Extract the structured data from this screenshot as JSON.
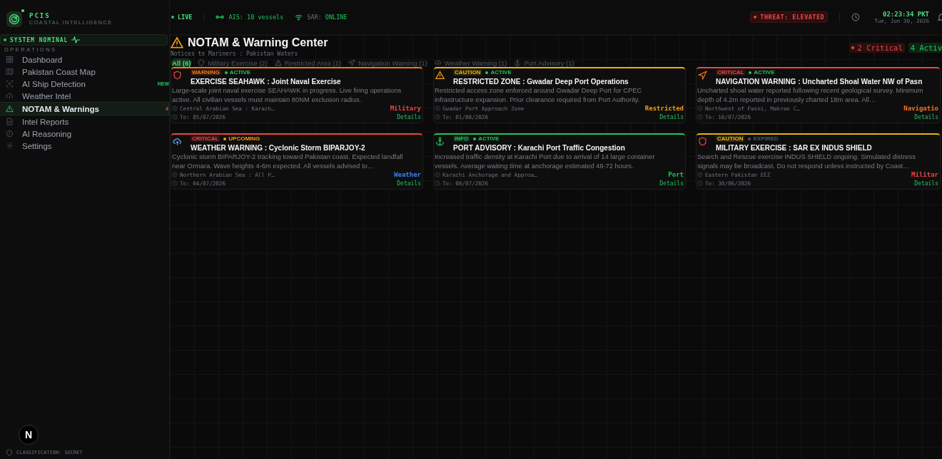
{
  "brand": {
    "name": "PCIS",
    "subtitle": "COASTAL INTELLIGENCE"
  },
  "system_status": "SYSTEM NOMINAL",
  "sidebar": {
    "section": "OPERATIONS",
    "items": [
      {
        "label": "Dashboard",
        "kind": "grid",
        "selected": false
      },
      {
        "label": "Pakistan Coast Map",
        "kind": "map",
        "selected": false
      },
      {
        "label": "AI Ship Detection",
        "kind": "scan",
        "selected": false,
        "badge": "NEW"
      },
      {
        "label": "Weather Intel",
        "kind": "cloud",
        "selected": false
      },
      {
        "label": "NOTAM & Warnings",
        "kind": "warning",
        "selected": true,
        "badge": "4"
      },
      {
        "label": "Intel Reports",
        "kind": "doc",
        "selected": false
      },
      {
        "label": "AI Reasoning",
        "kind": "brain",
        "selected": false
      },
      {
        "label": "Settings",
        "kind": "gear",
        "selected": false
      }
    ],
    "classification": "CLASSIFICATION: SECRET"
  },
  "dev_badge": "N",
  "topbar": {
    "live": "LIVE",
    "ais": "AIS: 10 vessels",
    "sar_label": "SAR:",
    "sar_value": "ONLINE",
    "threat": "THREAT: ELEVATED",
    "time": "02:23:34 PKT",
    "date": "Tue, Jun 30, 2026"
  },
  "page": {
    "title": "NOTAM & Warning Center",
    "subtitle": "Notices to Mariners : Pakistan Waters",
    "critical_count": "2 Critical",
    "active_count": "4 Activ"
  },
  "filters": [
    {
      "label": "All (6)",
      "kind": "none",
      "selected": true
    },
    {
      "label": "Military Exercise (2)",
      "kind": "shield",
      "selected": false
    },
    {
      "label": "Restricted Area (1)",
      "kind": "warning",
      "selected": false
    },
    {
      "label": "Navigation Warning (1)",
      "kind": "nav",
      "selected": false
    },
    {
      "label": "Weather Warning (1)",
      "kind": "cloud",
      "selected": false
    },
    {
      "label": "Port Advisory (1)",
      "kind": "anchor",
      "selected": false
    }
  ],
  "cards": [
    {
      "kind": "shield",
      "severity": {
        "label": "WARNING",
        "color": "#f97316"
      },
      "status": {
        "label": "ACTIVE",
        "color": "#22c55e"
      },
      "title": "EXERCISE SEAHAWK : Joint Naval Exercise",
      "description": "Large-scale joint naval exercise SEAHAWK in progress. Live firing operations active. All civilian vessels must maintain 80NM exclusion radius.",
      "location": "Central Arabian Sea : Karach…",
      "category": {
        "label": "Military",
        "color": "#ef4444"
      },
      "valid_to": "To: 05/07/2026",
      "details": "Details"
    },
    {
      "kind": "warning",
      "severity": {
        "label": "CAUTION",
        "color": "#eab308"
      },
      "status": {
        "label": "ACTIVE",
        "color": "#22c55e"
      },
      "title": "RESTRICTED ZONE : Gwadar Deep Port Operations",
      "description": "Restricted access zone enforced around Gwadar Deep Port for CPEC infrastructure expansion. Prior clearance required from Port Authority.",
      "location": "Gwadar Port Approach Zone",
      "category": {
        "label": "Restricted",
        "color": "#f59e0b"
      },
      "valid_to": "To: 01/08/2026",
      "details": "Details"
    },
    {
      "kind": "nav",
      "severity": {
        "label": "CRITICAL",
        "color": "#ef4444"
      },
      "status": {
        "label": "ACTIVE",
        "color": "#22c55e"
      },
      "title": "NAVIGATION WARNING : Uncharted Shoal Water NW of Pasn",
      "description": "Uncharted shoal water reported following recent geological survey. Minimum depth of 4.2m reported in previously charted 18m area. All…",
      "location": "Northwest of Pasni, Makran C…",
      "category": {
        "label": "Navigatio",
        "color": "#f97316"
      },
      "valid_to": "To: 16/07/2026",
      "details": "Details"
    },
    {
      "kind": "cloud",
      "severity": {
        "label": "CRITICAL",
        "color": "#ef4444"
      },
      "status": {
        "label": "UPCOMING",
        "color": "#f59e0b"
      },
      "title": "WEATHER WARNING : Cyclonic Storm BIPARJOY-2",
      "description": "Cyclonic storm BIPARJOY-2 tracking toward Pakistan coast. Expected landfall near Ormara. Wave heights 4-6m expected. All vessels advised to…",
      "location": "Northern Arabian Sea : All P…",
      "category": {
        "label": "Weather",
        "color": "#3b82f6"
      },
      "valid_to": "To: 04/07/2026",
      "details": "Details"
    },
    {
      "kind": "anchor",
      "severity": {
        "label": "INFO",
        "color": "#22c55e"
      },
      "status": {
        "label": "ACTIVE",
        "color": "#22c55e"
      },
      "title": "PORT ADVISORY : Karachi Port Traffic Congestion",
      "description": "Increased traffic density at Karachi Port due to arrival of 14 large container vessels. Average waiting time at anchorage estimated 48-72 hours.",
      "location": "Karachi Anchorage and Approa…",
      "category": {
        "label": "Port",
        "color": "#22c55e"
      },
      "valid_to": "To: 08/07/2026",
      "details": "Details"
    },
    {
      "kind": "shield",
      "severity": {
        "label": "CAUTION",
        "color": "#eab308"
      },
      "status": {
        "label": "EXPIRED",
        "color": "#4b5563"
      },
      "title": "MILITARY EXERCISE : SAR EX INDUS SHIELD",
      "description": "Search and Rescue exercise INDUS SHIELD ongoing. Simulated distress signals may be broadcast. Do not respond unless instructed by Coast…",
      "location": "Eastern Pakistan EEZ",
      "category": {
        "label": "Militar",
        "color": "#ef4444"
      },
      "valid_to": "To: 30/06/2026",
      "details": "Details"
    }
  ]
}
